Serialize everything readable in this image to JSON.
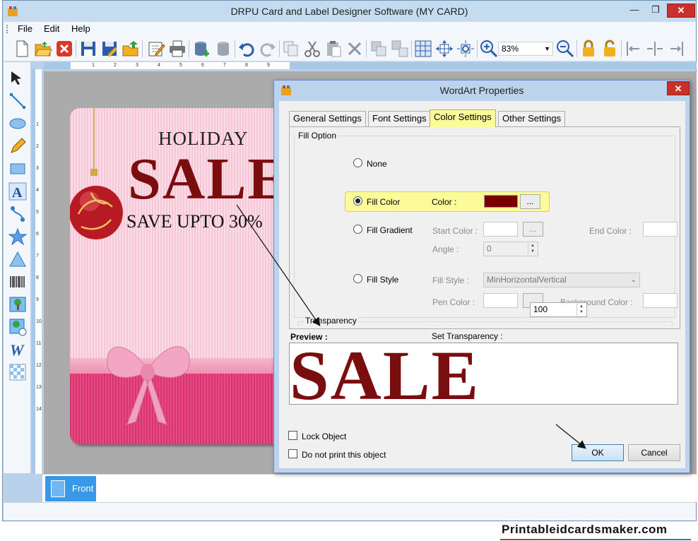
{
  "window": {
    "title": "DRPU Card and Label Designer Software  (MY CARD)",
    "minimize": "—",
    "maximize": "❐",
    "close": "✕"
  },
  "menu": {
    "file": "File",
    "edit": "Edit",
    "help": "Help"
  },
  "toolbar": {
    "zoom_value": "83%",
    "buttons": [
      "new-icon",
      "open-icon",
      "close-file-icon",
      "save-icon",
      "save-as-icon",
      "export-icon",
      "edit-icon",
      "print-icon",
      "database-add-icon",
      "database-icon",
      "undo-icon",
      "redo-icon",
      "copy-icon",
      "cut-icon",
      "paste-icon",
      "delete-icon",
      "group-icon",
      "ungroup-icon",
      "grid-icon",
      "move-icon",
      "rotate-icon",
      "zoom-in-icon",
      "zoom-out-icon",
      "lock-icon",
      "unlock-icon",
      "align-left-icon",
      "align-center-icon",
      "align-right-icon"
    ]
  },
  "left_tools": [
    "pointer-icon",
    "line-icon",
    "ellipse-icon",
    "pencil-icon",
    "rectangle-icon",
    "text-icon",
    "curve-icon",
    "star-icon",
    "triangle-icon",
    "barcode-icon",
    "image-icon",
    "image-library-icon",
    "wordart-icon",
    "watermark-icon"
  ],
  "ruler": {
    "h_numbers": [
      "1",
      "2",
      "3",
      "4",
      "5",
      "6",
      "7",
      "8",
      "9"
    ],
    "v_numbers": [
      "1",
      "2",
      "3",
      "4",
      "5",
      "6",
      "7",
      "8",
      "9",
      "10",
      "11",
      "12",
      "13",
      "14"
    ]
  },
  "card": {
    "holiday": "HOLIDAY",
    "sale": "SALE",
    "save": "SAVE UPTO 30%"
  },
  "page_tabs": {
    "front": "Front"
  },
  "dialog": {
    "title": "WordArt Properties",
    "close": "✕",
    "tabs": [
      "General Settings",
      "Font Settings",
      "Color Settings",
      "Other Settings"
    ],
    "active_tab": "Color Settings",
    "fill_option": {
      "group_label": "Fill Option",
      "selected": "Fill Color",
      "none": "None",
      "fill_color": "Fill Color",
      "color_label": "Color :",
      "color_value": "#7a0000",
      "browse": "...",
      "fill_gradient": "Fill Gradient",
      "start_color": "Start Color :",
      "end_color": "End Color :",
      "angle_label": "Angle :",
      "angle_value": "0",
      "fill_style": "Fill Style",
      "fill_style_label": "Fill Style :",
      "fill_style_value": "MinHorizontalVertical",
      "pen_color": "Pen Color :",
      "background_color": "Background Color :"
    },
    "transparency": {
      "group_label": "Transparency",
      "set_label": "Set Transparency :",
      "value": "100"
    },
    "preview_label": "Preview :",
    "preview_text": "SALE",
    "lock_object": "Lock Object",
    "do_not_print": "Do not print this object",
    "ok": "OK",
    "cancel": "Cancel"
  },
  "watermark": "Printableidcardsmaker.com",
  "colors": {
    "accent": "#fbfb9a",
    "sale_red": "#7a0d0d",
    "titlebar": "#c4dbf0"
  }
}
